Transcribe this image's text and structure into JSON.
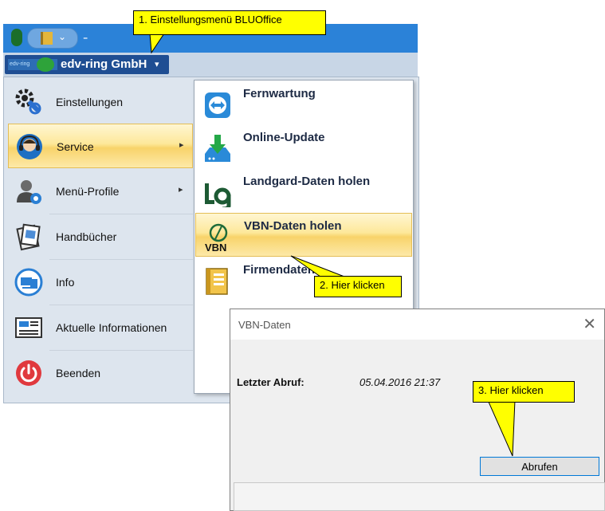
{
  "callouts": {
    "step1": "1. Einstellungsmenü BLUOffice",
    "step2": "2. Hier klicken",
    "step3": "3. Hier klicken"
  },
  "header": {
    "company_logo_text": "edv-ring",
    "company_name": "edv-ring GmbH",
    "company_caret": "▾",
    "qat_more": "₌"
  },
  "menu": {
    "items": [
      {
        "label": "Einstellungen",
        "icon": "gear-icon"
      },
      {
        "label": "Service",
        "icon": "headset-icon",
        "arrow": "▸"
      },
      {
        "label": "Menü-Profile",
        "icon": "user-settings-icon",
        "arrow": "▸"
      },
      {
        "label": "Handbücher",
        "icon": "manual-icon"
      },
      {
        "label": "Info",
        "icon": "info-icon"
      },
      {
        "label": "Aktuelle Informationen",
        "icon": "news-icon"
      },
      {
        "label": "Beenden",
        "icon": "power-icon"
      }
    ],
    "submenu": [
      {
        "label": "Fernwartung",
        "icon": "teamviewer-icon"
      },
      {
        "label": "Online-Update",
        "icon": "download-icon"
      },
      {
        "label": "Landgard-Daten holen",
        "icon": "landgard-icon"
      },
      {
        "label": "VBN-Daten holen",
        "icon": "vbn-icon"
      },
      {
        "label": "Firmendaten",
        "icon": "company-data-icon"
      }
    ]
  },
  "dialog": {
    "title": "VBN-Daten",
    "close": "✕",
    "last_fetch_label": "Letzter Abruf:",
    "last_fetch_value": "05.04.2016 21:37",
    "button_label": "Abrufen"
  },
  "colors": {
    "accent": "#2b82d8",
    "highlight": "#fde89a",
    "callout": "#ffff00"
  }
}
